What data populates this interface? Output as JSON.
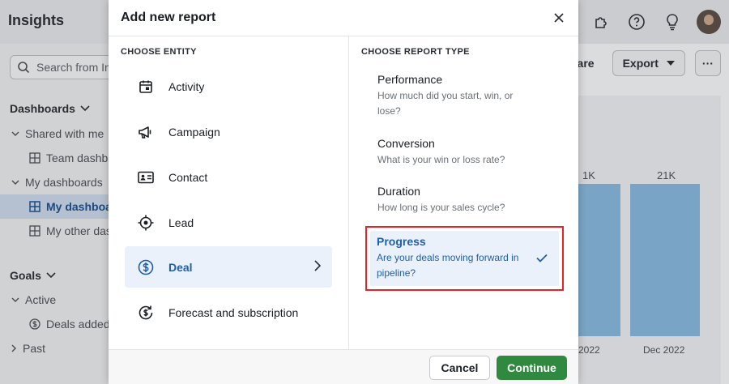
{
  "app": {
    "title": "Insights",
    "search_placeholder": "Search from In",
    "sidebar": {
      "dashboards_heading": "Dashboards",
      "items": [
        {
          "label": "Shared with me"
        },
        {
          "label": "Team dashb"
        },
        {
          "label": "My dashboards"
        },
        {
          "label": "My dashboa"
        },
        {
          "label": "My other das"
        }
      ],
      "goals_heading": "Goals",
      "goal_items": [
        {
          "label": "Active"
        },
        {
          "label": "Deals added"
        },
        {
          "label": "Past"
        }
      ]
    },
    "toolbar": {
      "share_label": "hare",
      "export_label": "Export",
      "more_label": "···"
    },
    "chart_data": {
      "type": "bar",
      "categories": [
        "",
        "Dec 2022"
      ],
      "x_labels": [
        "2022",
        "Dec 2022"
      ],
      "values": [
        21000,
        21000
      ],
      "value_labels": [
        "1K",
        "21K"
      ]
    }
  },
  "modal": {
    "title": "Add new report",
    "entity_heading": "CHOOSE ENTITY",
    "report_heading": "CHOOSE REPORT TYPE",
    "entities": [
      {
        "label": "Activity",
        "icon": "calendar-icon"
      },
      {
        "label": "Campaign",
        "icon": "megaphone-icon"
      },
      {
        "label": "Contact",
        "icon": "contact-card-icon"
      },
      {
        "label": "Lead",
        "icon": "target-icon"
      },
      {
        "label": "Deal",
        "icon": "dollar-circle-icon",
        "active": true
      },
      {
        "label": "Forecast and subscription",
        "icon": "forecast-icon"
      }
    ],
    "report_types": [
      {
        "title": "Performance",
        "description": "How much did you start, win, or lose?"
      },
      {
        "title": "Conversion",
        "description": "What is your win or loss rate?"
      },
      {
        "title": "Duration",
        "description": "How long is your sales cycle?"
      },
      {
        "title": "Progress",
        "description": "Are your deals moving forward in pipeline?",
        "selected": true
      }
    ],
    "cancel_label": "Cancel",
    "continue_label": "Continue"
  },
  "colors": {
    "accent_blue": "#1f5fa8",
    "selected_bg": "#ebf1fa",
    "highlight_red": "#e5242a",
    "continue_green": "#2f8a3f"
  }
}
